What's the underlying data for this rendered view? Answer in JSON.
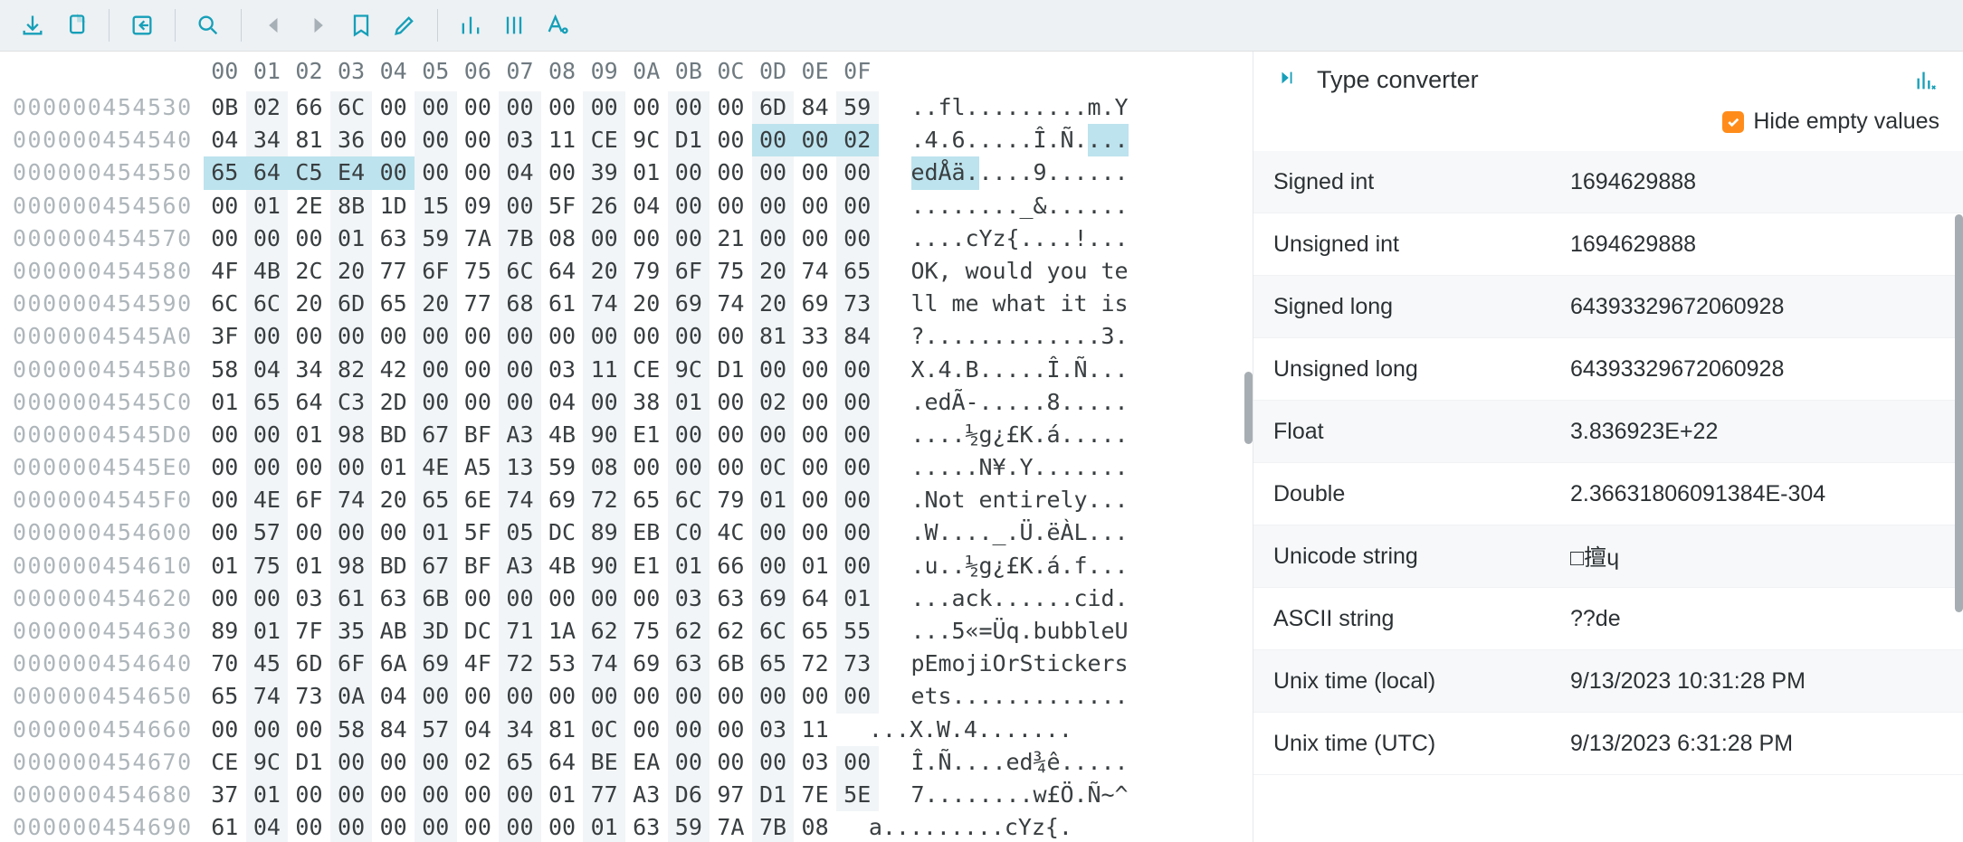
{
  "toolbar": {
    "icons": [
      "save",
      "copy",
      "share",
      "search",
      "prev",
      "next",
      "bookmark",
      "edit",
      "bar-chart",
      "columns",
      "format"
    ]
  },
  "hex": {
    "col_headers": [
      "00",
      "01",
      "02",
      "03",
      "04",
      "05",
      "06",
      "07",
      "08",
      "09",
      "0A",
      "0B",
      "0C",
      "0D",
      "0E",
      "0F"
    ],
    "rows": [
      {
        "offset": "000000454530",
        "bytes": [
          "0B",
          "02",
          "66",
          "6C",
          "00",
          "00",
          "00",
          "00",
          "00",
          "00",
          "00",
          "00",
          "00",
          "6D",
          "84",
          "59"
        ],
        "ascii": [
          "·",
          "·",
          "f",
          "l",
          "·",
          "·",
          "·",
          "·",
          "·",
          "·",
          "·",
          "·",
          "·",
          "m",
          ".",
          "Y"
        ],
        "sel_bytes": null,
        "sel_asc": null
      },
      {
        "offset": "000000454540",
        "bytes": [
          "04",
          "34",
          "81",
          "36",
          "00",
          "00",
          "00",
          "03",
          "11",
          "CE",
          "9C",
          "D1",
          "00",
          "00",
          "00",
          "02"
        ],
        "ascii": [
          "·",
          "4",
          ".",
          "6",
          "·",
          "·",
          "·",
          "·",
          "·",
          "Î",
          ".",
          "Ñ",
          "·",
          "·",
          "·",
          "·"
        ],
        "sel_bytes": [
          13,
          14,
          15
        ],
        "sel_asc": [
          13,
          14,
          15
        ]
      },
      {
        "offset": "000000454550",
        "bytes": [
          "65",
          "64",
          "C5",
          "E4",
          "00",
          "00",
          "00",
          "04",
          "00",
          "39",
          "01",
          "00",
          "00",
          "00",
          "00",
          "00"
        ],
        "ascii": [
          "e",
          "d",
          "Å",
          "ä",
          "·",
          "·",
          "·",
          "·",
          "·",
          "9",
          "·",
          "·",
          "·",
          "·",
          "·",
          "·"
        ],
        "sel_bytes": [
          0,
          1,
          2,
          3,
          4
        ],
        "sel_asc": [
          0,
          1,
          2,
          3,
          4
        ]
      },
      {
        "offset": "000000454560",
        "bytes": [
          "00",
          "01",
          "2E",
          "8B",
          "1D",
          "15",
          "09",
          "00",
          "5F",
          "26",
          "04",
          "00",
          "00",
          "00",
          "00",
          "00"
        ],
        "ascii": [
          "·",
          "·",
          "·",
          ".",
          "·",
          "·",
          "·",
          "·",
          "_",
          "&",
          "·",
          "·",
          "·",
          "·",
          "·",
          "·"
        ],
        "sel_bytes": null,
        "sel_asc": null
      },
      {
        "offset": "000000454570",
        "bytes": [
          "00",
          "00",
          "00",
          "01",
          "63",
          "59",
          "7A",
          "7B",
          "08",
          "00",
          "00",
          "00",
          "21",
          "00",
          "00",
          "00"
        ],
        "ascii": [
          "·",
          "·",
          "·",
          "·",
          "c",
          "Y",
          "z",
          "{",
          "·",
          "·",
          "·",
          "·",
          "!",
          "·",
          "·",
          "·"
        ],
        "sel_bytes": null,
        "sel_asc": null
      },
      {
        "offset": "000000454580",
        "bytes": [
          "4F",
          "4B",
          "2C",
          "20",
          "77",
          "6F",
          "75",
          "6C",
          "64",
          "20",
          "79",
          "6F",
          "75",
          "20",
          "74",
          "65"
        ],
        "ascii": [
          "O",
          "K",
          ",",
          " ",
          "w",
          "o",
          "u",
          "l",
          "d",
          " ",
          "y",
          "o",
          "u",
          " ",
          "t",
          "e"
        ],
        "sel_bytes": null,
        "sel_asc": null
      },
      {
        "offset": "000000454590",
        "bytes": [
          "6C",
          "6C",
          "20",
          "6D",
          "65",
          "20",
          "77",
          "68",
          "61",
          "74",
          "20",
          "69",
          "74",
          "20",
          "69",
          "73"
        ],
        "ascii": [
          "l",
          "l",
          " ",
          "m",
          "e",
          " ",
          "w",
          "h",
          "a",
          "t",
          " ",
          "i",
          "t",
          " ",
          "i",
          "s"
        ],
        "sel_bytes": null,
        "sel_asc": null
      },
      {
        "offset": "0000004545A0",
        "bytes": [
          "3F",
          "00",
          "00",
          "00",
          "00",
          "00",
          "00",
          "00",
          "00",
          "00",
          "00",
          "00",
          "00",
          "81",
          "33",
          "84"
        ],
        "ascii": [
          "?",
          "·",
          "·",
          "·",
          "·",
          "·",
          "·",
          "·",
          "·",
          "·",
          "·",
          "·",
          "·",
          ".",
          "3",
          "."
        ],
        "sel_bytes": null,
        "sel_asc": null
      },
      {
        "offset": "0000004545B0",
        "bytes": [
          "58",
          "04",
          "34",
          "82",
          "42",
          "00",
          "00",
          "00",
          "03",
          "11",
          "CE",
          "9C",
          "D1",
          "00",
          "00",
          "00"
        ],
        "ascii": [
          "X",
          "·",
          "4",
          ".",
          "B",
          "·",
          "·",
          "·",
          "·",
          "·",
          "Î",
          ".",
          "Ñ",
          "·",
          "·",
          "·"
        ],
        "sel_bytes": null,
        "sel_asc": null
      },
      {
        "offset": "0000004545C0",
        "bytes": [
          "01",
          "65",
          "64",
          "C3",
          "2D",
          "00",
          "00",
          "00",
          "04",
          "00",
          "38",
          "01",
          "00",
          "02",
          "00",
          "00"
        ],
        "ascii": [
          "·",
          "e",
          "d",
          "Ã",
          "-",
          "·",
          "·",
          "·",
          "·",
          "·",
          "8",
          "·",
          "·",
          "·",
          "·",
          "·"
        ],
        "sel_bytes": null,
        "sel_asc": null
      },
      {
        "offset": "0000004545D0",
        "bytes": [
          "00",
          "00",
          "01",
          "98",
          "BD",
          "67",
          "BF",
          "A3",
          "4B",
          "90",
          "E1",
          "00",
          "00",
          "00",
          "00",
          "00"
        ],
        "ascii": [
          "·",
          "·",
          "·",
          ".",
          "½",
          "g",
          "¿",
          "£",
          "K",
          ".",
          "á",
          "·",
          "·",
          "·",
          "·",
          "·"
        ],
        "sel_bytes": null,
        "sel_asc": null
      },
      {
        "offset": "0000004545E0",
        "bytes": [
          "00",
          "00",
          "00",
          "00",
          "01",
          "4E",
          "A5",
          "13",
          "59",
          "08",
          "00",
          "00",
          "00",
          "0C",
          "00",
          "00"
        ],
        "ascii": [
          "·",
          "·",
          "·",
          "·",
          "·",
          "N",
          "¥",
          "·",
          "Y",
          "·",
          "·",
          "·",
          "·",
          "·",
          "·",
          "·"
        ],
        "sel_bytes": null,
        "sel_asc": null
      },
      {
        "offset": "0000004545F0",
        "bytes": [
          "00",
          "4E",
          "6F",
          "74",
          "20",
          "65",
          "6E",
          "74",
          "69",
          "72",
          "65",
          "6C",
          "79",
          "01",
          "00",
          "00"
        ],
        "ascii": [
          "·",
          "N",
          "o",
          "t",
          " ",
          "e",
          "n",
          "t",
          "i",
          "r",
          "e",
          "l",
          "y",
          "·",
          "·",
          "·"
        ],
        "sel_bytes": null,
        "sel_asc": null
      },
      {
        "offset": "000000454600",
        "bytes": [
          "00",
          "57",
          "00",
          "00",
          "00",
          "01",
          "5F",
          "05",
          "DC",
          "89",
          "EB",
          "C0",
          "4C",
          "00",
          "00",
          "00"
        ],
        "ascii": [
          "·",
          "W",
          "·",
          "·",
          "·",
          "·",
          "_",
          "·",
          "Ü",
          ".",
          "ë",
          "À",
          "L",
          "·",
          "·",
          "·"
        ],
        "sel_bytes": null,
        "sel_asc": null
      },
      {
        "offset": "000000454610",
        "bytes": [
          "01",
          "75",
          "01",
          "98",
          "BD",
          "67",
          "BF",
          "A3",
          "4B",
          "90",
          "E1",
          "01",
          "66",
          "00",
          "01",
          "00"
        ],
        "ascii": [
          "·",
          "u",
          "·",
          ".",
          "½",
          "g",
          "¿",
          "£",
          "K",
          ".",
          "á",
          "·",
          "f",
          "·",
          "·",
          "·"
        ],
        "sel_bytes": null,
        "sel_asc": null
      },
      {
        "offset": "000000454620",
        "bytes": [
          "00",
          "00",
          "03",
          "61",
          "63",
          "6B",
          "00",
          "00",
          "00",
          "00",
          "00",
          "03",
          "63",
          "69",
          "64",
          "01"
        ],
        "ascii": [
          "·",
          "·",
          "·",
          "a",
          "c",
          "k",
          "·",
          "·",
          "·",
          "·",
          "·",
          "·",
          "c",
          "i",
          "d",
          "·"
        ],
        "sel_bytes": null,
        "sel_asc": null
      },
      {
        "offset": "000000454630",
        "bytes": [
          "89",
          "01",
          "7F",
          "35",
          "AB",
          "3D",
          "DC",
          "71",
          "1A",
          "62",
          "75",
          "62",
          "62",
          "6C",
          "65",
          "55"
        ],
        "ascii": [
          ".",
          "·",
          ".",
          "5",
          "«",
          "=",
          "Ü",
          "q",
          "·",
          "b",
          "u",
          "b",
          "b",
          "l",
          "e",
          "U"
        ],
        "sel_bytes": null,
        "sel_asc": null
      },
      {
        "offset": "000000454640",
        "bytes": [
          "70",
          "45",
          "6D",
          "6F",
          "6A",
          "69",
          "4F",
          "72",
          "53",
          "74",
          "69",
          "63",
          "6B",
          "65",
          "72",
          "73"
        ],
        "ascii": [
          "p",
          "E",
          "m",
          "o",
          "j",
          "i",
          "O",
          "r",
          "S",
          "t",
          "i",
          "c",
          "k",
          "e",
          "r",
          "s"
        ],
        "sel_bytes": null,
        "sel_asc": null
      },
      {
        "offset": "000000454650",
        "bytes": [
          "65",
          "74",
          "73",
          "0A",
          "04",
          "00",
          "00",
          "00",
          "00",
          "00",
          "00",
          "00",
          "00",
          "00",
          "00",
          "00"
        ],
        "ascii": [
          "e",
          "t",
          "s",
          "·",
          "·",
          "·",
          "·",
          "·",
          "·",
          "·",
          "·",
          "·",
          "·",
          "·",
          "·",
          "·"
        ],
        "sel_bytes": null,
        "sel_asc": null
      },
      {
        "offset": "000000454660",
        "bytes": [
          "00",
          "00",
          "00",
          "58",
          "84",
          "57",
          "04",
          "34",
          "81",
          "0C",
          "00",
          "00",
          "00",
          "03",
          "11"
        ],
        "ascii": [
          "·",
          "·",
          "·",
          "X",
          ".",
          "W",
          "·",
          "4",
          ".",
          "·",
          "·",
          "·",
          "·",
          "·",
          "·"
        ],
        "sel_bytes": null,
        "sel_asc": null
      },
      {
        "offset": "000000454670",
        "bytes": [
          "CE",
          "9C",
          "D1",
          "00",
          "00",
          "00",
          "02",
          "65",
          "64",
          "BE",
          "EA",
          "00",
          "00",
          "00",
          "03",
          "00"
        ],
        "ascii": [
          "Î",
          ".",
          "Ñ",
          "·",
          "·",
          "·",
          "·",
          "e",
          "d",
          "¾",
          "ê",
          "·",
          "·",
          "·",
          "·",
          "·"
        ],
        "sel_bytes": null,
        "sel_asc": null
      },
      {
        "offset": "000000454680",
        "bytes": [
          "37",
          "01",
          "00",
          "00",
          "00",
          "00",
          "00",
          "00",
          "01",
          "77",
          "A3",
          "D6",
          "97",
          "D1",
          "7E",
          "5E"
        ],
        "ascii": [
          "7",
          "·",
          "·",
          "·",
          "·",
          "·",
          "·",
          "·",
          "·",
          "w",
          "£",
          "Ö",
          ".",
          "Ñ",
          "~",
          "^"
        ],
        "sel_bytes": null,
        "sel_asc": null
      },
      {
        "offset": "000000454690",
        "bytes": [
          "61",
          "04",
          "00",
          "00",
          "00",
          "00",
          "00",
          "00",
          "00",
          "01",
          "63",
          "59",
          "7A",
          "7B",
          "08"
        ],
        "ascii": [
          "a",
          "·",
          "·",
          "·",
          "·",
          "·",
          "·",
          "·",
          "·",
          "·",
          "c",
          "Y",
          "z",
          "{",
          "·"
        ],
        "sel_bytes": null,
        "sel_asc": null
      }
    ]
  },
  "side": {
    "title": "Type converter",
    "hide_label": "Hide empty values",
    "types": [
      {
        "label": "Signed int",
        "value": "1694629888"
      },
      {
        "label": "Unsigned int",
        "value": "1694629888"
      },
      {
        "label": "Signed long",
        "value": "64393329672060928"
      },
      {
        "label": "Unsigned long",
        "value": "64393329672060928"
      },
      {
        "label": "Float",
        "value": "3.836923E+22"
      },
      {
        "label": "Double",
        "value": "2.36631806091384E-304"
      },
      {
        "label": "Unicode string",
        "value": "□擅ɥ"
      },
      {
        "label": "ASCII string",
        "value": "??de"
      },
      {
        "label": "Unix time (local)",
        "value": "9/13/2023 10:31:28 PM"
      },
      {
        "label": "Unix time (UTC)",
        "value": "9/13/2023 6:31:28 PM"
      }
    ]
  }
}
